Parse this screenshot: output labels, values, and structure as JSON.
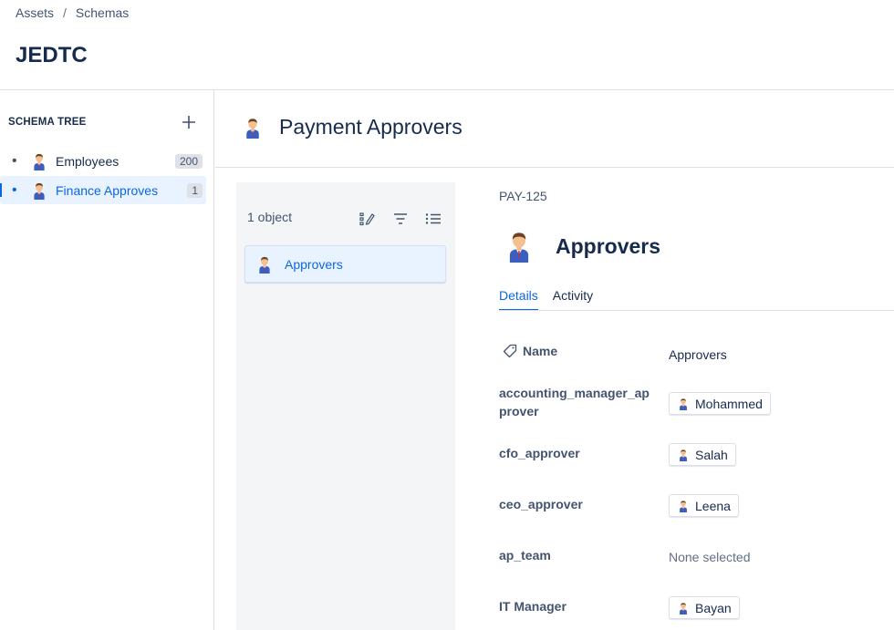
{
  "breadcrumb": {
    "items": [
      "Assets",
      "Schemas"
    ],
    "separator": "/"
  },
  "page": {
    "title": "JEDTC"
  },
  "sidebar": {
    "heading": "SCHEMA TREE",
    "items": [
      {
        "label": "Employees",
        "count": "200",
        "icon": "person-icon",
        "selected": false
      },
      {
        "label": "Finance Approves",
        "count": "1",
        "icon": "person-icon",
        "selected": true
      }
    ]
  },
  "object_type": {
    "title": "Payment Approvers",
    "icon": "person-icon"
  },
  "list": {
    "count_label": "1 object",
    "items": [
      {
        "label": "Approvers"
      }
    ]
  },
  "detail": {
    "key": "PAY-125",
    "title": "Approvers",
    "tabs": [
      {
        "label": "Details",
        "active": true
      },
      {
        "label": "Activity",
        "active": false
      }
    ],
    "attributes": {
      "name": {
        "label": "Name",
        "value": "Approvers"
      },
      "accounting": {
        "label_line1": "accounting_manager_ap",
        "label_line2": "prover",
        "value": "Mohammed"
      },
      "cfo": {
        "label": "cfo_approver",
        "value": "Salah"
      },
      "ceo": {
        "label": "ceo_approver",
        "value": "Leena"
      },
      "ap_team": {
        "label": "ap_team",
        "value": "None selected"
      },
      "it_manager": {
        "label": "IT Manager",
        "value": "Bayan"
      }
    }
  },
  "colors": {
    "accent": "#0c66e4",
    "selected_bg": "#e9f2ff",
    "panel_bg": "#f4f5f7"
  }
}
